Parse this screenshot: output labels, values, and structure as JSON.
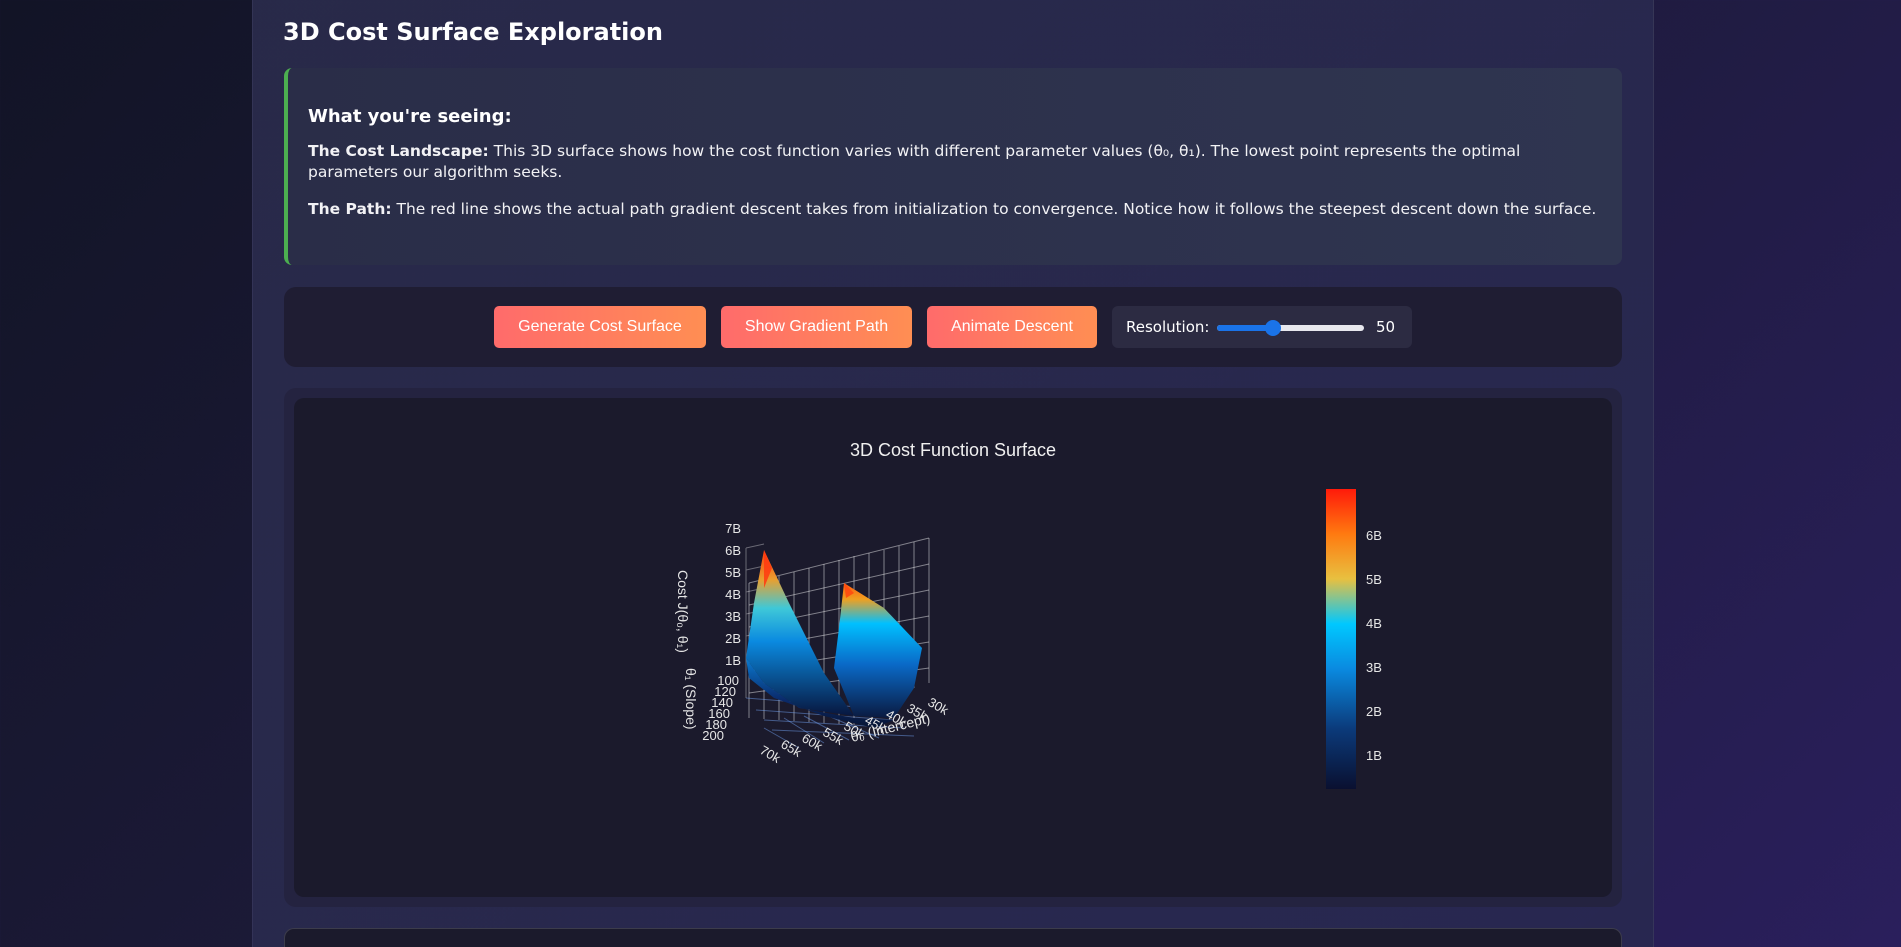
{
  "section": {
    "title": "3D Cost Surface Exploration"
  },
  "info": {
    "heading": "What you're seeing:",
    "p1_label": "The Cost Landscape:",
    "p1_text": " This 3D surface shows how the cost function varies with different parameter values (θ₀, θ₁). The lowest point represents the optimal parameters our algorithm seeks.",
    "p2_label": "The Path:",
    "p2_text": " The red line shows the actual path gradient descent takes from initialization to convergence. Notice how it follows the steepest descent down the surface."
  },
  "controls": {
    "generate_label": "Generate Cost Surface",
    "show_path_label": "Show Gradient Path",
    "animate_label": "Animate Descent",
    "resolution_label": "Resolution:",
    "resolution_value": "50",
    "resolution_fraction": 0.38
  },
  "colors": {
    "button_gradient_start": "#ff6b6b",
    "button_gradient_end": "#ff8e53",
    "info_accent": "#4caf50",
    "slider": "#1a73e8"
  },
  "chart_data": {
    "type": "surface3d",
    "title": "3D Cost Function Surface",
    "z_axis": {
      "label": "Cost J(θ₀, θ₁)",
      "ticks": [
        "1B",
        "2B",
        "3B",
        "4B",
        "5B",
        "6B",
        "7B"
      ]
    },
    "y_axis": {
      "label": "θ₁ (Slope)",
      "ticks": [
        "100",
        "120",
        "140",
        "160",
        "180",
        "200"
      ]
    },
    "x_axis": {
      "label": "θ₀ (Intercept)",
      "ticks": [
        "30k",
        "35k",
        "40k",
        "45k",
        "50k",
        "55k",
        "60k",
        "65k",
        "70k"
      ]
    },
    "colorbar": {
      "ticks": [
        "1B",
        "2B",
        "3B",
        "4B",
        "5B",
        "6B"
      ],
      "colorscale": [
        "#0a1030",
        "#0b3a7a",
        "#0a7fd6",
        "#00c8ff",
        "#e8c040",
        "#ff7a10",
        "#ff1a0a"
      ]
    }
  }
}
